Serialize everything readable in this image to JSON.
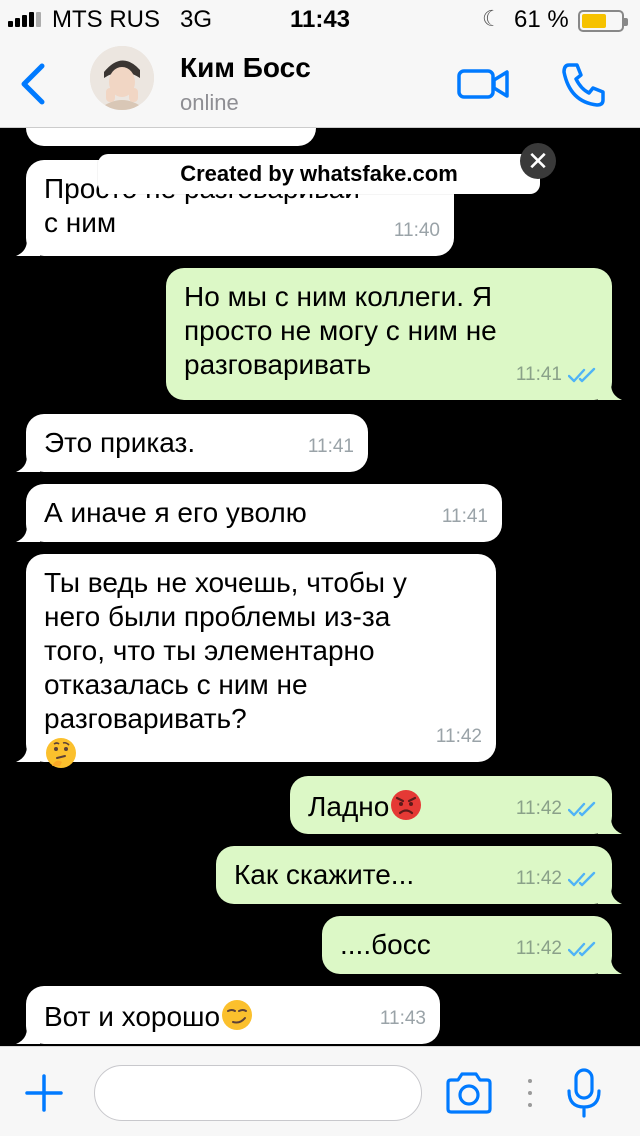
{
  "status_bar": {
    "carrier": "MTS RUS",
    "network": "3G",
    "time": "11:43",
    "battery": "61 %"
  },
  "header": {
    "contact_name": "Ким Босс",
    "contact_status": "online"
  },
  "watermark": {
    "text": "Created by whatsfake.com",
    "close_glyph": "✕"
  },
  "messages": [
    {
      "dir": "in",
      "text": "Просто не разговаривай\nс ним",
      "time": "11:40"
    },
    {
      "dir": "out",
      "text": "Но мы с ним коллеги. Я\nпросто не могу с ним не\nразговаривать",
      "time": "11:41"
    },
    {
      "dir": "in",
      "text": "Это приказ.",
      "time": "11:41"
    },
    {
      "dir": "in",
      "text": "А иначе я его уволю",
      "time": "11:41"
    },
    {
      "dir": "in",
      "text": "Ты ведь не хочешь, чтобы у\nнего были проблемы из-за\nтого, что ты элементарно\nотказалась с ним не\nразговаривать?",
      "time": "11:42",
      "emoji": "thinking-face"
    },
    {
      "dir": "out",
      "text": "Ладно",
      "time": "11:42",
      "emoji": "angry-face"
    },
    {
      "dir": "out",
      "text": "Как скажите...",
      "time": "11:42"
    },
    {
      "dir": "out",
      "text": "....босс",
      "time": "11:42"
    },
    {
      "dir": "in",
      "text": "Вот и хорошо",
      "time": "11:43",
      "emoji": "smirking-face"
    }
  ],
  "input": {
    "value": "",
    "placeholder": ""
  },
  "colors": {
    "accent": "#007aff",
    "incoming_bubble": "#ffffff",
    "outgoing_bubble": "#dcf8c6",
    "read_ticks": "#4fb3f6",
    "chat_background": "#000000"
  },
  "icons": [
    "back-chevron-icon",
    "video-call-icon",
    "phone-call-icon",
    "plus-icon",
    "camera-icon",
    "microphone-icon",
    "double-check-icon"
  ]
}
